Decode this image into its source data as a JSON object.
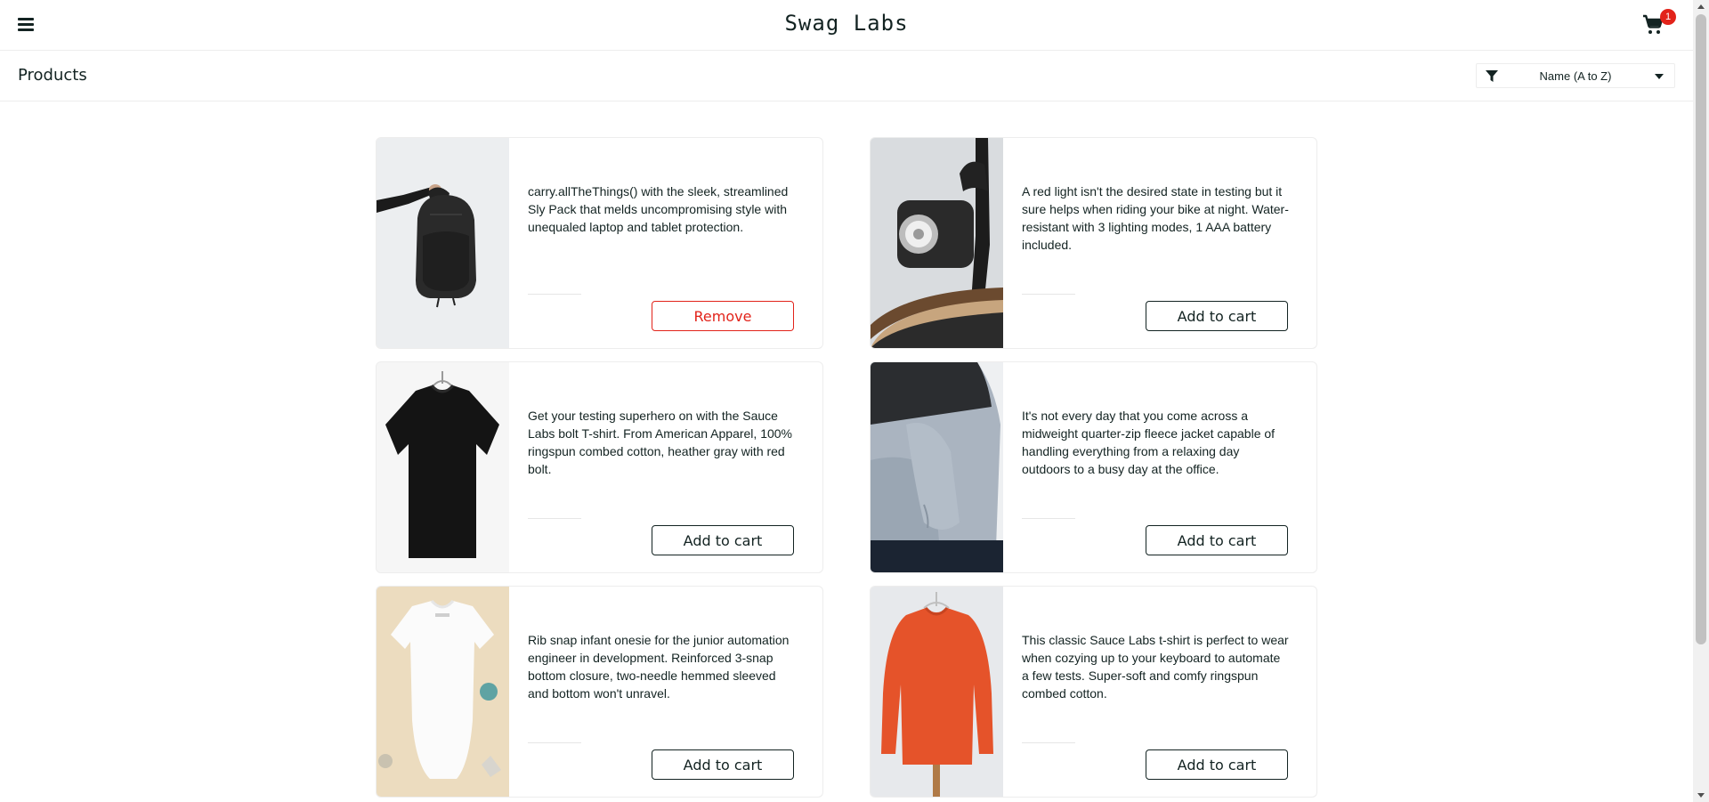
{
  "header": {
    "logo": "Swag Labs",
    "cart_count": "1"
  },
  "subheader": {
    "title": "Products",
    "sort_selected": "Name (A to Z)"
  },
  "products": [
    {
      "description": "carry.allTheThings() with the sleek, streamlined Sly Pack that melds uncompromising style with unequaled laptop and tablet protection.",
      "button": "Remove",
      "image": "black-backpack"
    },
    {
      "description": "A red light isn't the desired state in testing but it sure helps when riding your bike at night. Water-resistant with 3 lighting modes, 1 AAA battery included.",
      "button": "Add to cart",
      "image": "bike-light"
    },
    {
      "description": "Get your testing superhero on with the Sauce Labs bolt T-shirt. From American Apparel, 100% ringspun combed cotton, heather gray with red bolt.",
      "button": "Add to cart",
      "image": "black-tshirt"
    },
    {
      "description": "It's not every day that you come across a midweight quarter-zip fleece jacket capable of handling everything from a relaxing day outdoors to a busy day at the office.",
      "button": "Add to cart",
      "image": "fleece-jacket"
    },
    {
      "description": "Rib snap infant onesie for the junior automation engineer in development. Reinforced 3-snap bottom closure, two-needle hemmed sleeved and bottom won't unravel.",
      "button": "Add to cart",
      "image": "white-onesie"
    },
    {
      "description": "This classic Sauce Labs t-shirt is perfect to wear when cozying up to your keyboard to automate a few tests. Super-soft and comfy ringspun combed cotton.",
      "button": "Add to cart",
      "image": "red-sweatshirt"
    }
  ],
  "colors": {
    "accent_red": "#e2231a",
    "text": "#132322",
    "border": "#ededed"
  }
}
